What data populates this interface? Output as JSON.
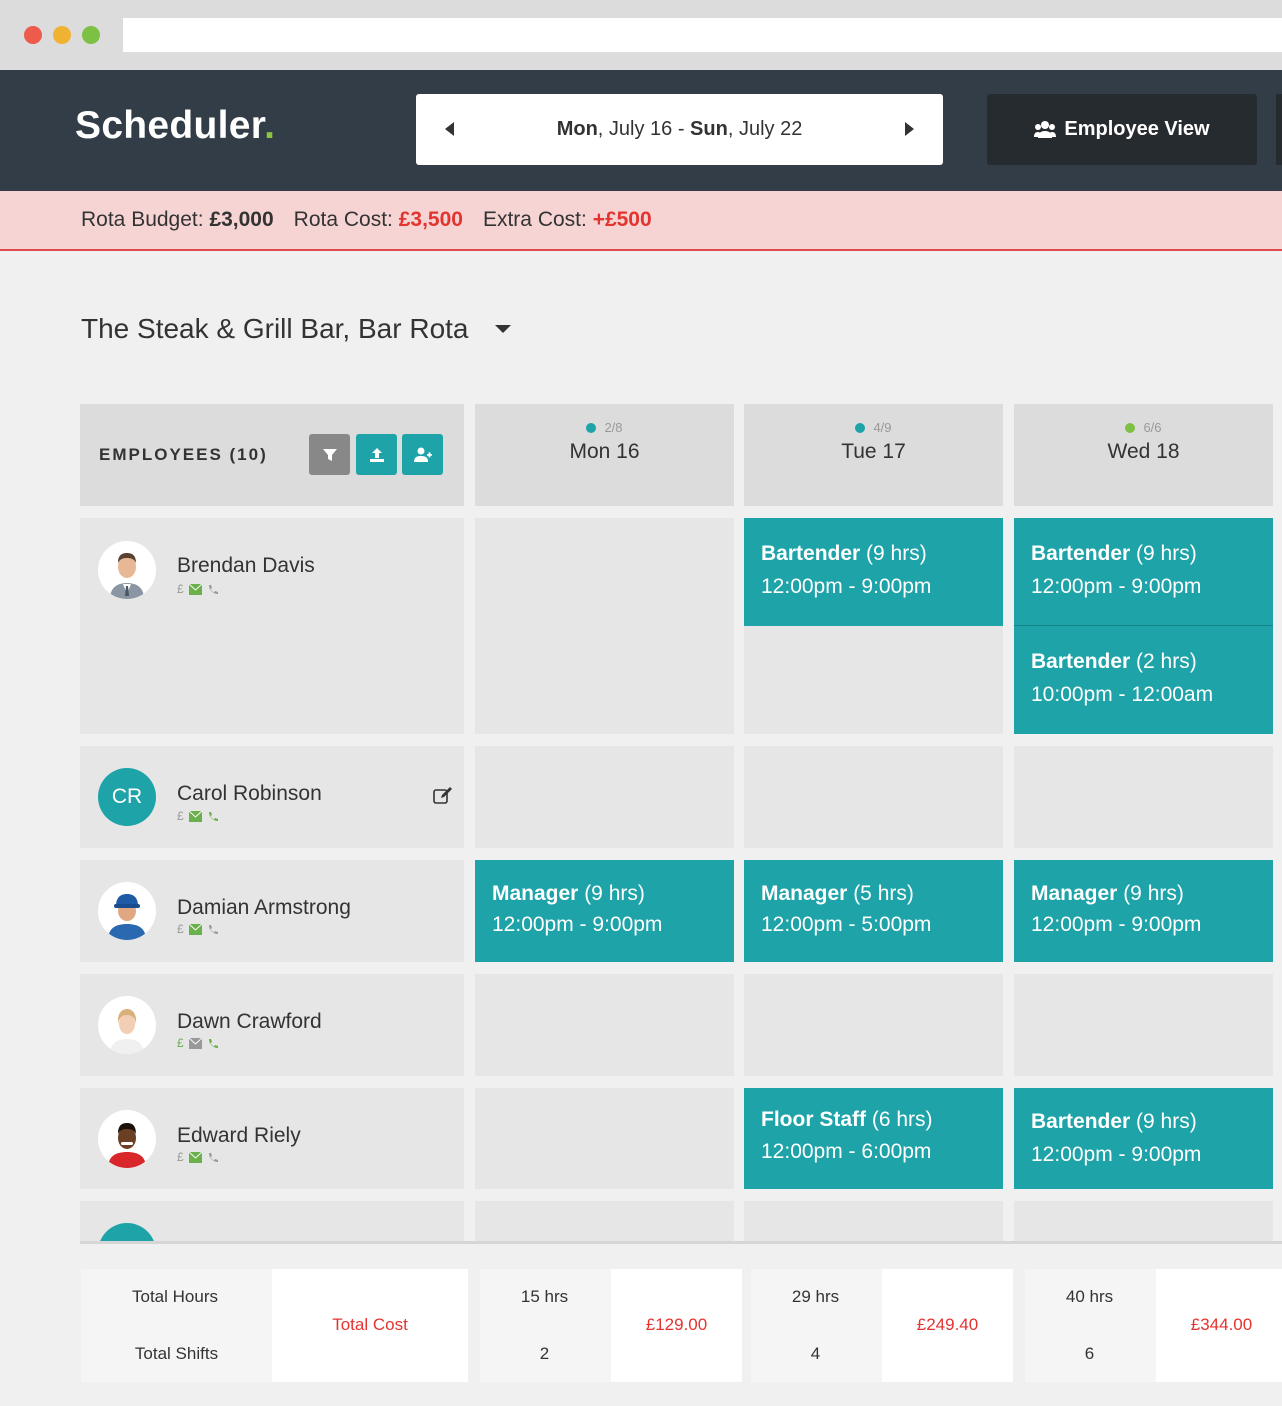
{
  "app": {
    "title": "Scheduler",
    "title_dot": "."
  },
  "date_range": {
    "start_day": "Mon",
    "start_rest": ", July 16 - ",
    "end_day": "Sun",
    "end_rest": ", July 22"
  },
  "employee_view_label": "Employee View",
  "budget": {
    "budget_label": "Rota Budget:",
    "budget_value": "£3,000",
    "cost_label": "Rota Cost:",
    "cost_value": "£3,500",
    "extra_label": "Extra Cost:",
    "extra_value": "+£500"
  },
  "rota_title": "The Steak & Grill Bar, Bar Rota",
  "employees_header": "EMPLOYEES (10)",
  "days": [
    {
      "label": "Mon 16",
      "status": "2/8",
      "dot_color": "#1ea3a8"
    },
    {
      "label": "Tue 17",
      "status": "4/9",
      "dot_color": "#1ea3a8"
    },
    {
      "label": "Wed 18",
      "status": "6/6",
      "dot_color": "#7dc144"
    }
  ],
  "employees": [
    {
      "name": "Brendan Davis",
      "icon_pound": "£"
    },
    {
      "name": "Carol Robinson",
      "initials": "CR",
      "icon_pound": "£"
    },
    {
      "name": "Damian Armstrong",
      "icon_pound": "£"
    },
    {
      "name": "Dawn Crawford",
      "icon_pound": "£"
    },
    {
      "name": "Edward Riely",
      "icon_pound": "£"
    }
  ],
  "shifts": {
    "brendan_tue": {
      "role": "Bartender",
      "hours": " (9 hrs)",
      "time": "12:00pm - 9:00pm"
    },
    "brendan_wed_1": {
      "role": "Bartender",
      "hours": " (9 hrs)",
      "time": "12:00pm - 9:00pm"
    },
    "brendan_wed_2": {
      "role": "Bartender",
      "hours": " (2 hrs)",
      "time": "10:00pm - 12:00am"
    },
    "damian_mon": {
      "role": "Manager",
      "hours": " (9 hrs)",
      "time": "12:00pm - 9:00pm"
    },
    "damian_tue": {
      "role": "Manager",
      "hours": " (5 hrs)",
      "time": "12:00pm - 5:00pm"
    },
    "damian_wed": {
      "role": "Manager",
      "hours": " (9 hrs)",
      "time": "12:00pm - 9:00pm"
    },
    "edward_tue": {
      "role": "Floor Staff",
      "hours": " (6 hrs)",
      "time": "12:00pm - 6:00pm"
    },
    "edward_wed": {
      "role": "Bartender",
      "hours": " (9 hrs)",
      "time": "12:00pm - 9:00pm"
    }
  },
  "totals": {
    "hours_label": "Total Hours",
    "shifts_label": "Total Shifts",
    "cost_label": "Total Cost",
    "days": [
      {
        "hours": "15 hrs",
        "shifts": "2",
        "cost": "£129.00"
      },
      {
        "hours": "29 hrs",
        "shifts": "4",
        "cost": "£249.40"
      },
      {
        "hours": "40 hrs",
        "shifts": "6",
        "cost": "£344.00"
      }
    ]
  },
  "colors": {
    "accent": "#1ea3a8",
    "brand_dot": "#8cc641",
    "negative": "#e3342f",
    "header_bg": "#333d47"
  }
}
